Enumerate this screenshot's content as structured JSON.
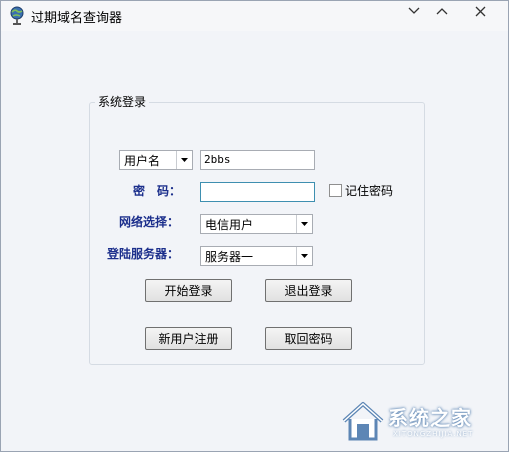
{
  "window": {
    "title": "过期域名查询器"
  },
  "login": {
    "group_title": "系统登录",
    "account_type": "用户名",
    "username_value": "2bbs",
    "password_label": "密　码：",
    "password_value": "",
    "remember_label": "记住密码",
    "remember_checked": false,
    "network_label": "网络选择：",
    "network_value": "电信用户",
    "server_label": "登陆服务器：",
    "server_value": "服务器一"
  },
  "buttons": {
    "start_login": "开始登录",
    "logout": "退出登录",
    "register": "新用户注册",
    "retrieve_password": "取回密码"
  },
  "watermark": {
    "main": "系统之家",
    "sub": "XITONGZHIJIA.NET"
  }
}
